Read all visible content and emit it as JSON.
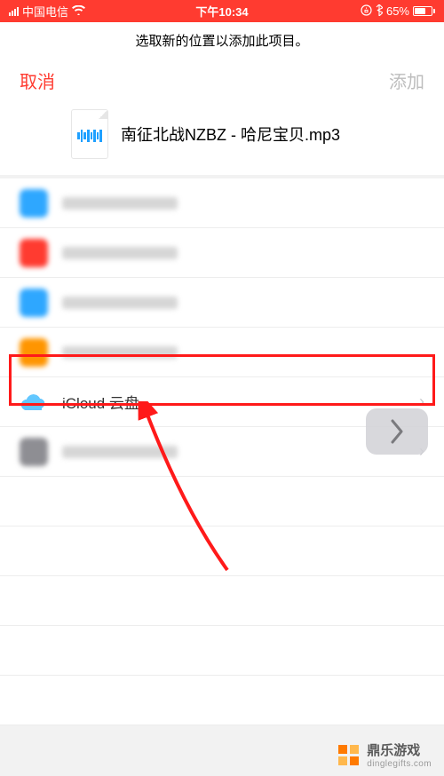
{
  "status_bar": {
    "carrier": "中国电信",
    "time": "下午10:34",
    "battery_pct": "65%"
  },
  "header": {
    "instruction": "选取新的位置以添加此项目。",
    "cancel_label": "取消",
    "add_label": "添加"
  },
  "file": {
    "name": "南征北战NZBZ - 哈尼宝贝.mp3"
  },
  "locations": {
    "icloud_label": "iCloud 云盘"
  },
  "watermark": {
    "brand": "鼎乐游戏",
    "url": "dinglegifts.com"
  }
}
